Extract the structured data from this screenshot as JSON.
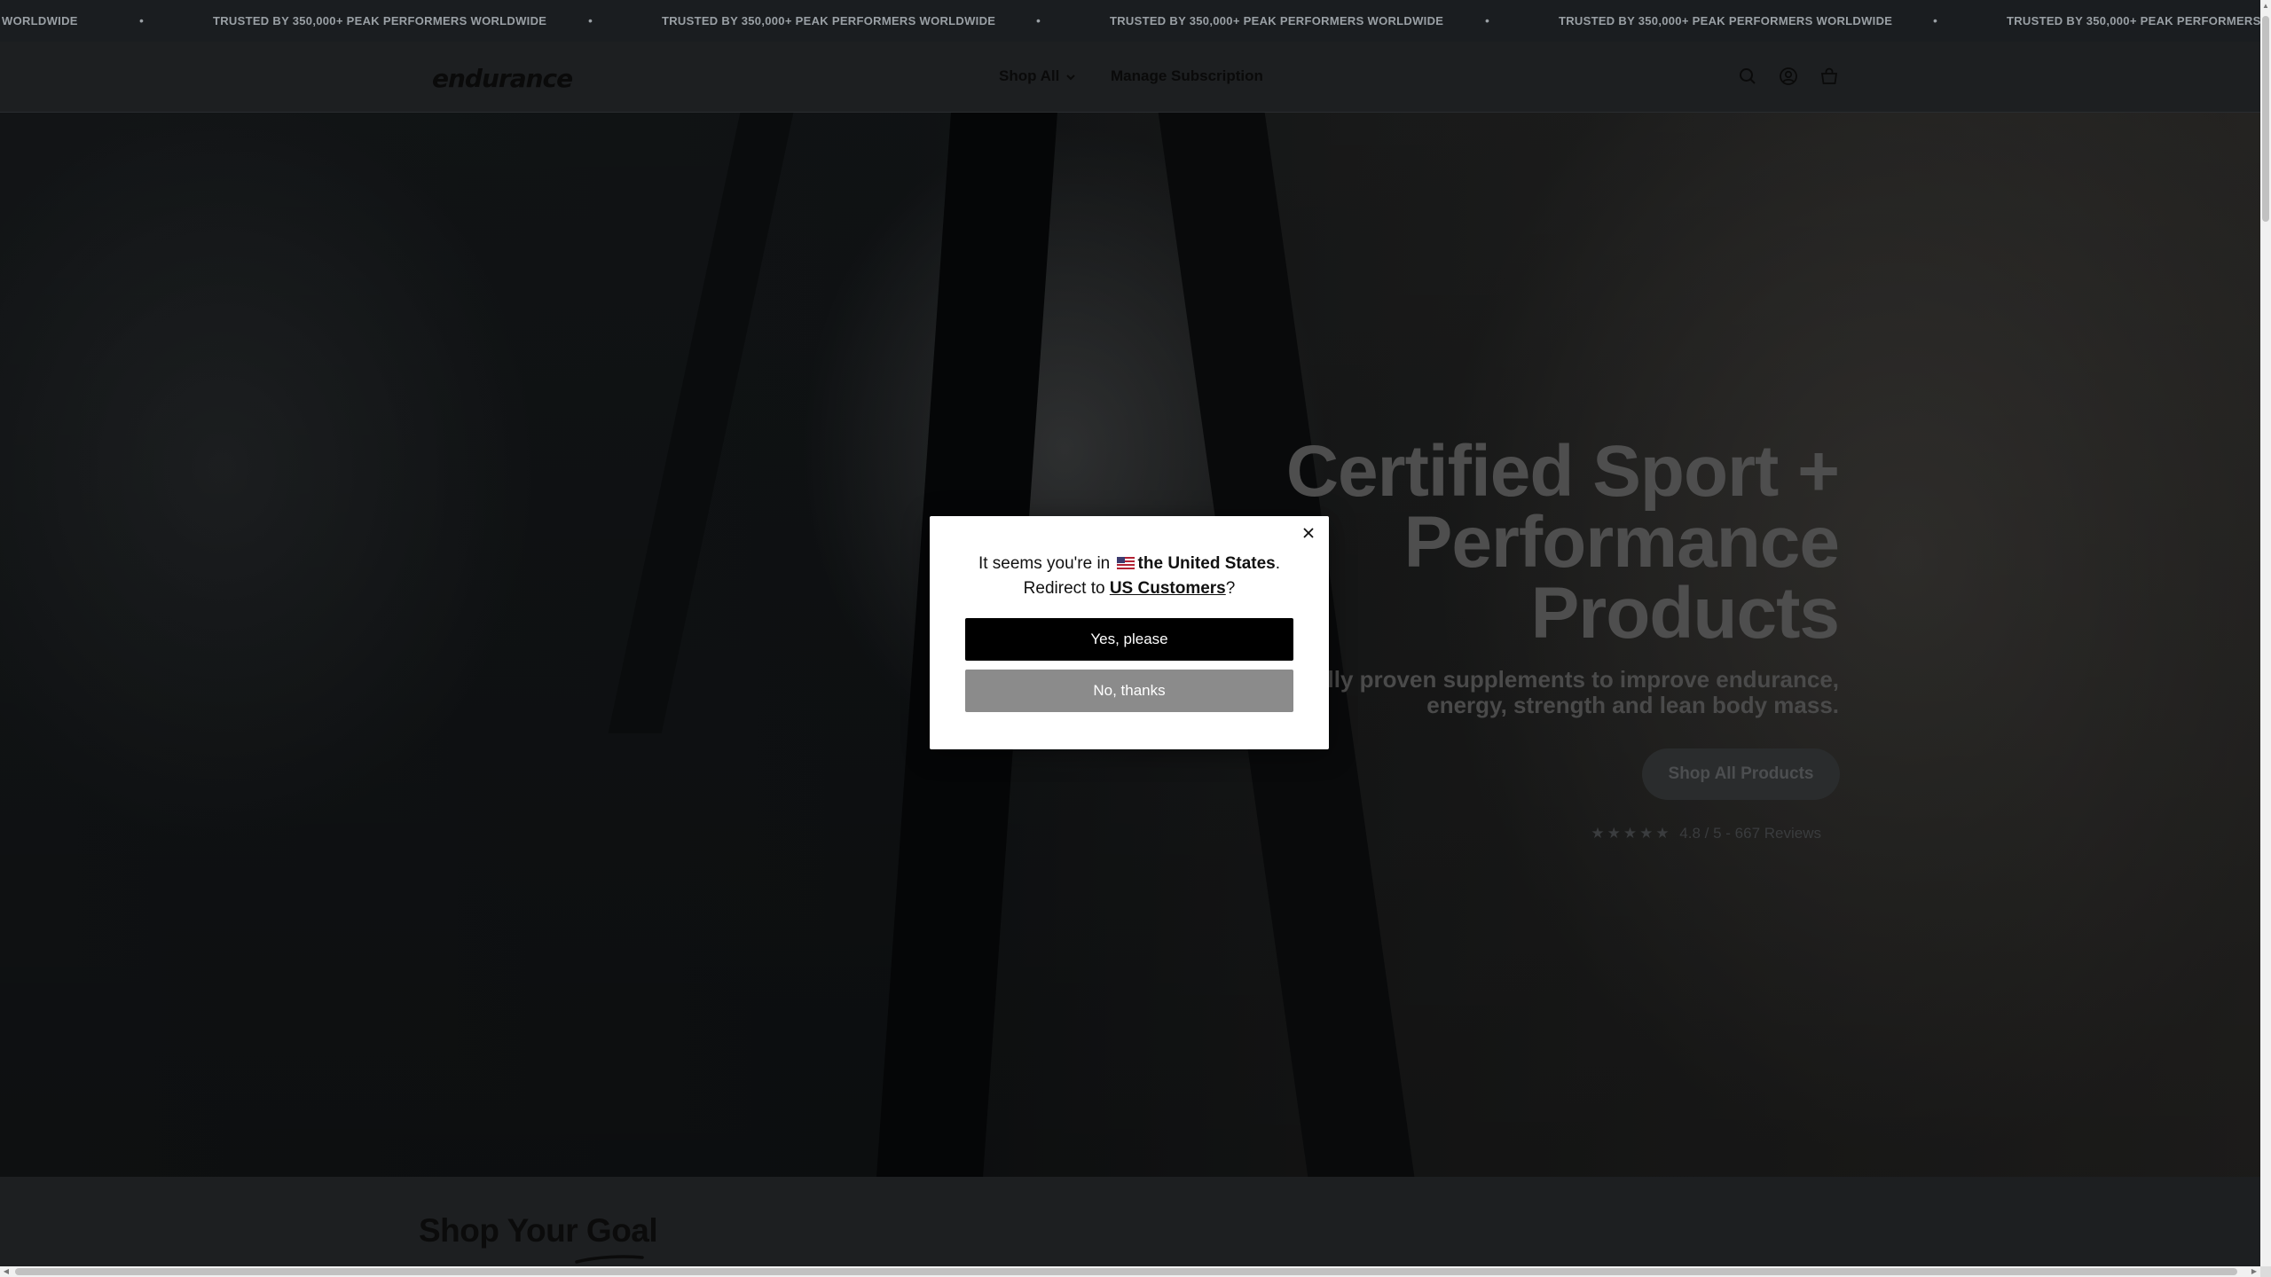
{
  "announcement": {
    "text": "TRUSTED BY 350,000+ PEAK PERFORMERS WORLDWIDE",
    "fragment": "WORLDWIDE",
    "separator": "•"
  },
  "header": {
    "logo": "endurance",
    "nav": [
      {
        "label": "Shop All"
      },
      {
        "label": "Manage Subscription"
      }
    ],
    "icons": [
      "search-icon",
      "account-icon",
      "cart-icon"
    ]
  },
  "hero": {
    "title_lines": [
      "Certified Sport +",
      "Performance",
      "Products"
    ],
    "subtitle_lines": [
      "Clinically proven supplements to improve endurance,",
      "energy, strength and lean body mass."
    ],
    "cta": "Shop All Products",
    "rating": {
      "stars": "★★★★★",
      "score_text": "4.8 / 5 - 667 Reviews",
      "value": 4.8
    }
  },
  "goal_section": {
    "title_prefix": "Shop Your ",
    "title_highlight": "Goal"
  },
  "modal": {
    "line1_prefix": "It seems you're in",
    "country": "the United States",
    "line1_suffix": ".",
    "line2_prefix": "Redirect to ",
    "store": "US Customers",
    "line2_suffix": "?",
    "yes_label": "Yes, please",
    "no_label": "No, thanks"
  },
  "colors": {
    "modal_bg": "#ffffff",
    "yes_button": "#000000",
    "no_button": "#8b8b8b",
    "overlay": "#000000"
  }
}
